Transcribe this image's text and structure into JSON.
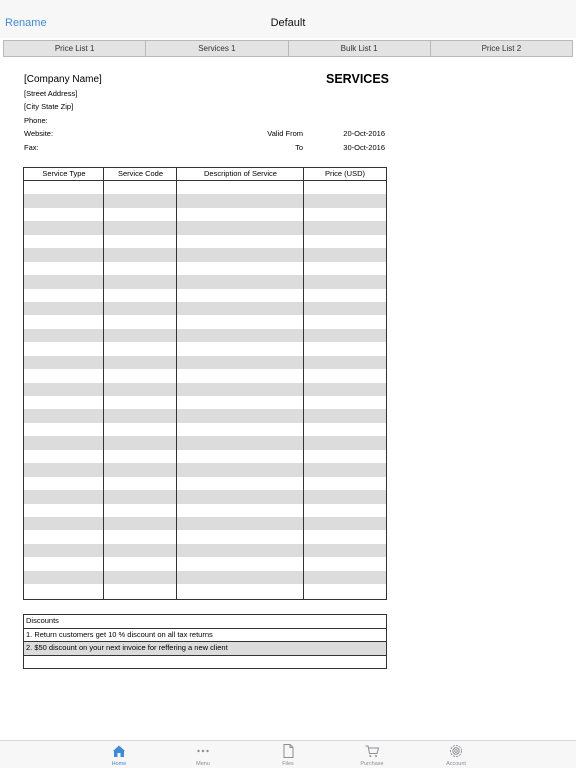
{
  "nav": {
    "left_action": "Rename",
    "title": "Default"
  },
  "tabs": [
    "Price List 1",
    "Services 1",
    "Bulk List 1",
    "Price List 2"
  ],
  "doc": {
    "company_name": "[Company Name]",
    "street_address": "[Street Address]",
    "city_state_zip": "[City State Zip]",
    "phone_label": "Phone:",
    "website_label": "Website:",
    "fax_label": "Fax:",
    "heading": "SERVICES",
    "valid_from_label": "Valid From",
    "valid_from_value": "20-Oct-2016",
    "to_label": "To",
    "to_value": "30-Oct-2016"
  },
  "services_table": {
    "columns": [
      "Service Type",
      "Service Code",
      "Description of Service",
      "Price (USD)"
    ],
    "row_count": 31
  },
  "discounts": {
    "header": "Discounts",
    "items": [
      "1. Return customers get 10 % discount on all tax returns",
      "2. $50 discount on your next invoice for reffering a new client",
      ""
    ]
  },
  "tabbar": {
    "items": [
      {
        "label": "Home",
        "icon": "home-icon",
        "active": true
      },
      {
        "label": "Menu",
        "icon": "more-dots-icon",
        "active": false
      },
      {
        "label": "Files",
        "icon": "file-icon",
        "active": false
      },
      {
        "label": "Purchase",
        "icon": "cart-icon",
        "active": false
      },
      {
        "label": "Account",
        "icon": "gear-icon",
        "active": false
      }
    ],
    "accent_color": "#3d8bd9",
    "inactive_color": "#8e8e93"
  }
}
